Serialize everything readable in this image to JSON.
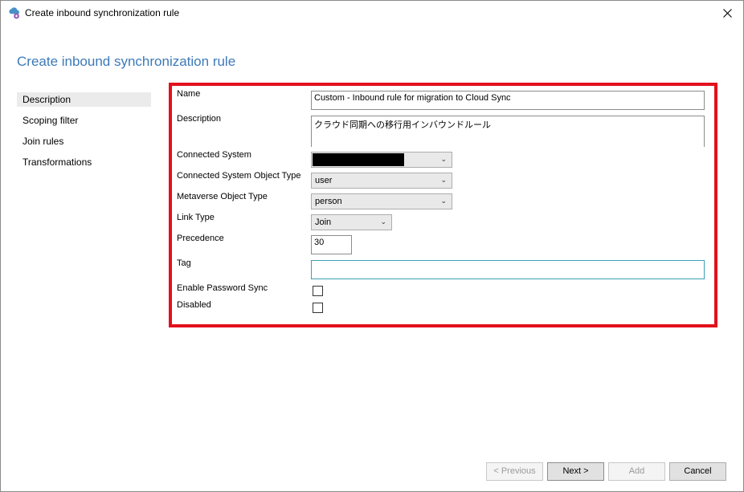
{
  "window": {
    "title": "Create inbound synchronization rule"
  },
  "page": {
    "heading": "Create inbound synchronization rule"
  },
  "nav": {
    "items": [
      {
        "label": "Description",
        "selected": true
      },
      {
        "label": "Scoping filter",
        "selected": false
      },
      {
        "label": "Join rules",
        "selected": false
      },
      {
        "label": "Transformations",
        "selected": false
      }
    ]
  },
  "form": {
    "name": {
      "label": "Name",
      "value": "Custom - Inbound rule for migration to Cloud Sync"
    },
    "description": {
      "label": "Description",
      "value": "クラウド同期への移行用インバウンドルール"
    },
    "connected_system": {
      "label": "Connected System",
      "value": "",
      "redacted": true
    },
    "connected_system_object_type": {
      "label": "Connected System Object Type",
      "value": "user"
    },
    "metaverse_object_type": {
      "label": "Metaverse Object Type",
      "value": "person"
    },
    "link_type": {
      "label": "Link Type",
      "value": "Join"
    },
    "precedence": {
      "label": "Precedence",
      "value": "30"
    },
    "tag": {
      "label": "Tag",
      "value": ""
    },
    "enable_password_sync": {
      "label": "Enable Password Sync",
      "checked": false
    },
    "disabled": {
      "label": "Disabled",
      "checked": false
    }
  },
  "buttons": {
    "previous": "< Previous",
    "next": "Next >",
    "add": "Add",
    "cancel": "Cancel"
  },
  "colors": {
    "accent": "#3c7ab8",
    "highlight": "#e3101c",
    "tag_border": "#3c9fb5"
  }
}
